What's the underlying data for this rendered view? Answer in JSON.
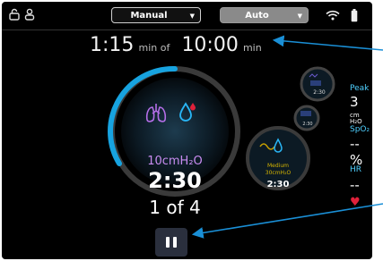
{
  "topbar": {
    "lock_icon": "unlock-icon",
    "user_icon": "user-icon",
    "mode_manual": "Manual",
    "mode_auto": "Auto",
    "wifi_icon": "wifi-icon",
    "battery_icon": "battery-icon"
  },
  "timer": {
    "elapsed": "1:15",
    "of_label": "min of",
    "total": "10:00",
    "unit": "min"
  },
  "therapy": {
    "icons": [
      "lungs-icon",
      "droplet-icon"
    ],
    "pressure": "10cmH₂O",
    "time_remaining": "2:30",
    "progress": "1 of 4"
  },
  "queue": {
    "items": [
      {
        "time": "2:30"
      },
      {
        "time": "2:30"
      },
      {
        "label": "Medium",
        "pressure": "30cmH₂O",
        "time": "2:30"
      }
    ]
  },
  "stats": {
    "peak_label": "Peak",
    "peak_value": "3",
    "peak_unit_top": "cm",
    "peak_unit_bottom": "H₂O",
    "spo2_label": "SpO₂",
    "spo2_value": "--%",
    "hr_label": "HR",
    "hr_value": "--",
    "heart_color": "#e0213a"
  },
  "colors": {
    "accent": "#1ab0e8",
    "progress_arc": "#17a3e0",
    "pressure_text": "#c88cf0",
    "callout": "#1a8fd6"
  }
}
